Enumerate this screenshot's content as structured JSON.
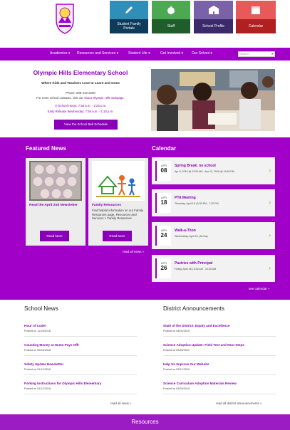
{
  "header": {
    "logo": "school-crest-logo",
    "quick_links": [
      {
        "label": "Student Family Portals",
        "icon": "pencil-icon"
      },
      {
        "label": "Staff",
        "icon": "apple-icon"
      },
      {
        "label": "School Profile",
        "icon": "school-building-icon"
      },
      {
        "label": "Calendar",
        "icon": "calendar-icon"
      }
    ]
  },
  "nav": {
    "items": [
      "Academics ▾",
      "Resources and Services ▾",
      "Student Life ▾",
      "Get Involved ▾",
      "Our School ▾"
    ],
    "search_placeholder": "Search",
    "search_button": "▸"
  },
  "intro": {
    "title": "Olympic Hills Elementary School",
    "tagline": "Where Kids and Teachers Love to Learn and Grow",
    "phone": "Phone: 206-413-2200",
    "contacts_prefix": "For more school contacts, visit our ",
    "contacts_link": "About Olympic Hills webpage.",
    "hours": "◷ School Hours: 7:55 a.m. - 2:25 p.m.",
    "early_release": "Early Release Wednesday: 7:55 a.m. - 1:10 p.m.",
    "bell_button": "View the School Bell Schedule"
  },
  "featured": {
    "heading": "Featured News",
    "cards": [
      {
        "title": "Read the April 2nd Newsletter",
        "desc": "",
        "button": "Read More",
        "image": "cookies-photo"
      },
      {
        "title": "Family Resources",
        "desc": "Find helpful information on our Family Resources page. Resources and Services > Family Resources",
        "button": "Read More",
        "image": "family-drawing"
      }
    ],
    "all_link": "read all news »"
  },
  "calendar": {
    "heading": "Calendar",
    "events": [
      {
        "month": "APR",
        "day": "08",
        "title": "Spring Break: no school",
        "time": "Apr 8, 2019 @ 12:00 AM - Apr 12, 2019 @ 11:59 PM"
      },
      {
        "month": "APR",
        "day": "18",
        "title": "PTA Meeting",
        "time": "Thursday, April 18  |  6:30 PM - 7:30 PM"
      },
      {
        "month": "APR",
        "day": "24",
        "title": "Walk-a-Thon",
        "time": "Wednesday, April 24  |  All Day"
      },
      {
        "month": "APR",
        "day": "26",
        "title": "Pastries with Principal",
        "time": "Friday, April 26  |  8:30 AM - 10:30 AM"
      }
    ],
    "see_link": "see calendar »"
  },
  "school_news": {
    "heading": "School News",
    "items": [
      {
        "title": "Hour of Code!",
        "date": "Posted on 11/19/2018"
      },
      {
        "title": "Counting Money at Home Pays Off!",
        "date": "Posted on 05/23/2018"
      },
      {
        "title": "Safety Update Newsletter",
        "date": "Posted on 01/12/2018"
      },
      {
        "title": "Parking Instructions for Olympic Hills Elementary",
        "date": "Posted on 01/12/2018"
      }
    ],
    "more": "read all news »"
  },
  "district": {
    "heading": "District Announcements",
    "items": [
      {
        "title": "State of the District: Equity and Excellence",
        "date": "Posted on 04/04/2019"
      },
      {
        "title": "Science Adoption Update: Field Test and Next Steps",
        "date": "Posted on 03/28/2019"
      },
      {
        "title": "Help Us Improve Our Website",
        "date": "Posted on 03/21/2019"
      },
      {
        "title": "Science Curriculum Adoption Materials Review",
        "date": "Posted on 03/28/2019"
      }
    ],
    "more": "read all district announcements »"
  },
  "footer": {
    "resources": "Resources"
  },
  "colors": {
    "brand_purple": "#a000c8",
    "link_purple": "#8a00b8"
  }
}
